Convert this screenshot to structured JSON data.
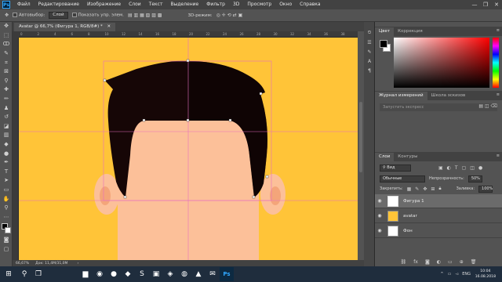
{
  "menubar": {
    "logo": "Ps",
    "items": [
      "Файл",
      "Редактирование",
      "Изображение",
      "Слои",
      "Текст",
      "Выделение",
      "Фильтр",
      "3D",
      "Просмотр",
      "Окно",
      "Справка"
    ],
    "win_controls": [
      "—",
      "❐",
      "✕"
    ]
  },
  "options": {
    "autoselect_label": "Автовыбор:",
    "autoselect_value": "Слой",
    "show_controls_label": "Показать упр. элем.",
    "mode_3d": "3D-режим:"
  },
  "document": {
    "tab_title": "Avatar @ 66,7% (Фигура 1, RGB/8#) *",
    "ruler_numbers": [
      "0",
      "2",
      "4",
      "6",
      "8",
      "10",
      "12",
      "14",
      "16",
      "18",
      "20",
      "22",
      "24",
      "26",
      "28",
      "30",
      "32",
      "34",
      "36",
      "38"
    ]
  },
  "status": {
    "zoom": "66,67%",
    "doc_info": "Док: 11,4M/31,0M"
  },
  "color_panel": {
    "tabs": [
      "Цвет",
      "Коррекция"
    ],
    "fg_color": "#000000",
    "bg_color": "#ffffff"
  },
  "history_panel": {
    "tabs": [
      "Журнал измерений",
      "Школа эскизов"
    ],
    "empty_text": "Запустить экспресс"
  },
  "layers_panel": {
    "tabs": [
      "Слои",
      "Контуры"
    ],
    "kind_label": "Вид",
    "blend_mode": "Обычные",
    "opacity_label": "Непрозрачность:",
    "opacity_value": "50%",
    "lock_label": "Закрепить:",
    "fill_label": "Заливка:",
    "fill_value": "100%",
    "layers": [
      {
        "name": "Фигура 1",
        "selected": true,
        "thumb": "shape"
      },
      {
        "name": "avatar",
        "selected": false,
        "thumb": "avatar"
      },
      {
        "name": "Фон",
        "selected": false,
        "thumb": "white"
      }
    ]
  },
  "taskbar": {
    "lang": "ENG",
    "time": "10:04",
    "date": "16.08.2018"
  },
  "colors": {
    "canvas_bg": "#ffc438",
    "skin": "#fcc099",
    "skin_dark": "#f4a57a",
    "hair": "#160606",
    "guide": "#e86fc0"
  }
}
